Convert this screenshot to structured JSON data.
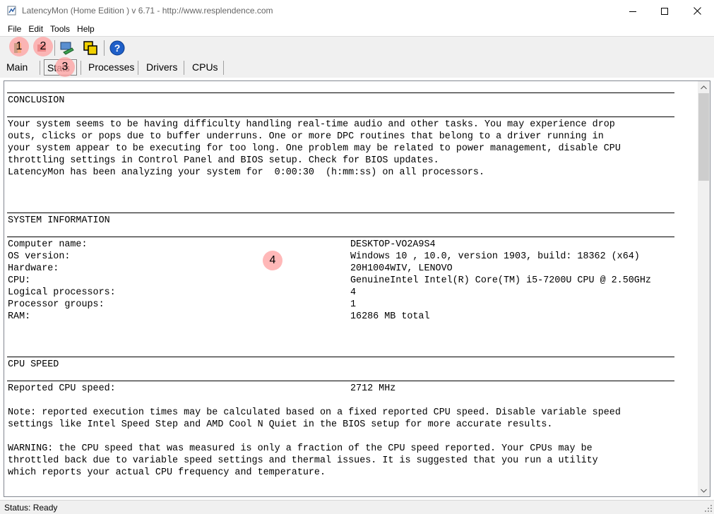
{
  "window": {
    "title": "LatencyMon  (Home Edition )  v 6.71 - http://www.resplendence.com"
  },
  "menu": [
    "File",
    "Edit",
    "Tools",
    "Help"
  ],
  "toolbar": {
    "buttons": [
      "start-icon",
      "stop-icon",
      "drivers-icon",
      "window-icon",
      "help-icon"
    ],
    "help_glyph": "?"
  },
  "tabs": [
    {
      "label": "Main"
    },
    {
      "label": "Stats",
      "selected": true
    },
    {
      "label": "Processes"
    },
    {
      "label": "Drivers"
    },
    {
      "label": "CPUs"
    }
  ],
  "markers": [
    "1",
    "2",
    "3",
    "4"
  ],
  "report": {
    "conclusion_header": "CONCLUSION",
    "conclusion_lines": [
      "Your system seems to be having difficulty handling real-time audio and other tasks. You may experience drop",
      "outs, clicks or pops due to buffer underruns. One or more DPC routines that belong to a driver running in",
      "your system appear to be executing for too long. One problem may be related to power management, disable CPU",
      "throttling settings in Control Panel and BIOS setup. Check for BIOS updates.",
      "LatencyMon has been analyzing your system for  0:00:30  (h:mm:ss) on all processors."
    ],
    "sysinfo_header": "SYSTEM INFORMATION",
    "sysinfo": [
      {
        "label": "Computer name:",
        "value": "DESKTOP-VO2A9S4"
      },
      {
        "label": "OS version:",
        "value": "Windows 10 , 10.0, version 1903, build: 18362 (x64)"
      },
      {
        "label": "Hardware:",
        "value": "20H1004WIV, LENOVO"
      },
      {
        "label": "CPU:",
        "value": "GenuineIntel Intel(R) Core(TM) i5-7200U CPU @ 2.50GHz"
      },
      {
        "label": "Logical processors:",
        "value": "4"
      },
      {
        "label": "Processor groups:",
        "value": "1"
      },
      {
        "label": "RAM:",
        "value": "16286 MB total"
      }
    ],
    "cpuspeed_header": "CPU SPEED",
    "cpuspeed": {
      "label": "Reported CPU speed:",
      "value": "2712 MHz"
    },
    "note_lines": [
      "Note: reported execution times may be calculated based on a fixed reported CPU speed. Disable variable speed",
      "settings like Intel Speed Step and AMD Cool N Quiet in the BIOS setup for more accurate results."
    ],
    "warning_lines": [
      "WARNING: the CPU speed that was measured is only a fraction of the CPU speed reported. Your CPUs may be",
      "throttled back due to variable speed settings and thermal issues. It is suggested that you run a utility",
      "which reports your actual CPU frequency and temperature."
    ]
  },
  "status": {
    "text": "Status: Ready"
  }
}
